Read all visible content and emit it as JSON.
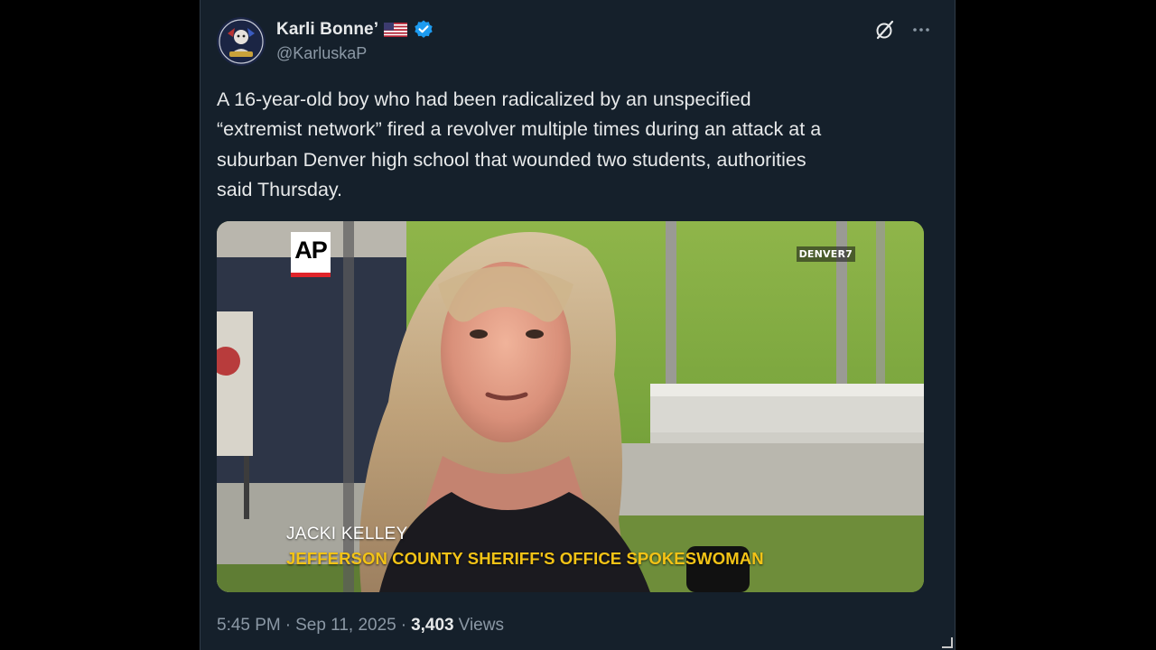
{
  "author": {
    "display_name": "Karli Bonne’",
    "handle": "@KarluskaP",
    "verified": true,
    "flag": "us-flag-icon"
  },
  "actions": {
    "grok_icon": "grok-slash-icon",
    "more_icon": "more-options-icon"
  },
  "tweet": {
    "text": "A 16-year-old boy who had been radicalized by an unspecified\n“extremist network” fired a revolver multiple times during an attack at a\nsuburban Denver high school that wounded two students, authorities\nsaid Thursday."
  },
  "media": {
    "watermark_left": "AP",
    "watermark_right": "DENVER7",
    "caption_name": "JACKI KELLEY",
    "caption_title": "JEFFERSON COUNTY SHERIFF'S OFFICE SPOKESWOMAN"
  },
  "meta": {
    "time": "5:45 PM",
    "separator": "·",
    "date": "Sep 11, 2025",
    "views_count": "3,403",
    "views_label": "Views"
  },
  "colors": {
    "background": "#15202b",
    "text_primary": "#e7e9ea",
    "text_secondary": "#8b98a5",
    "verified_blue": "#1d9bf0",
    "caption_yellow": "#f3c316"
  }
}
